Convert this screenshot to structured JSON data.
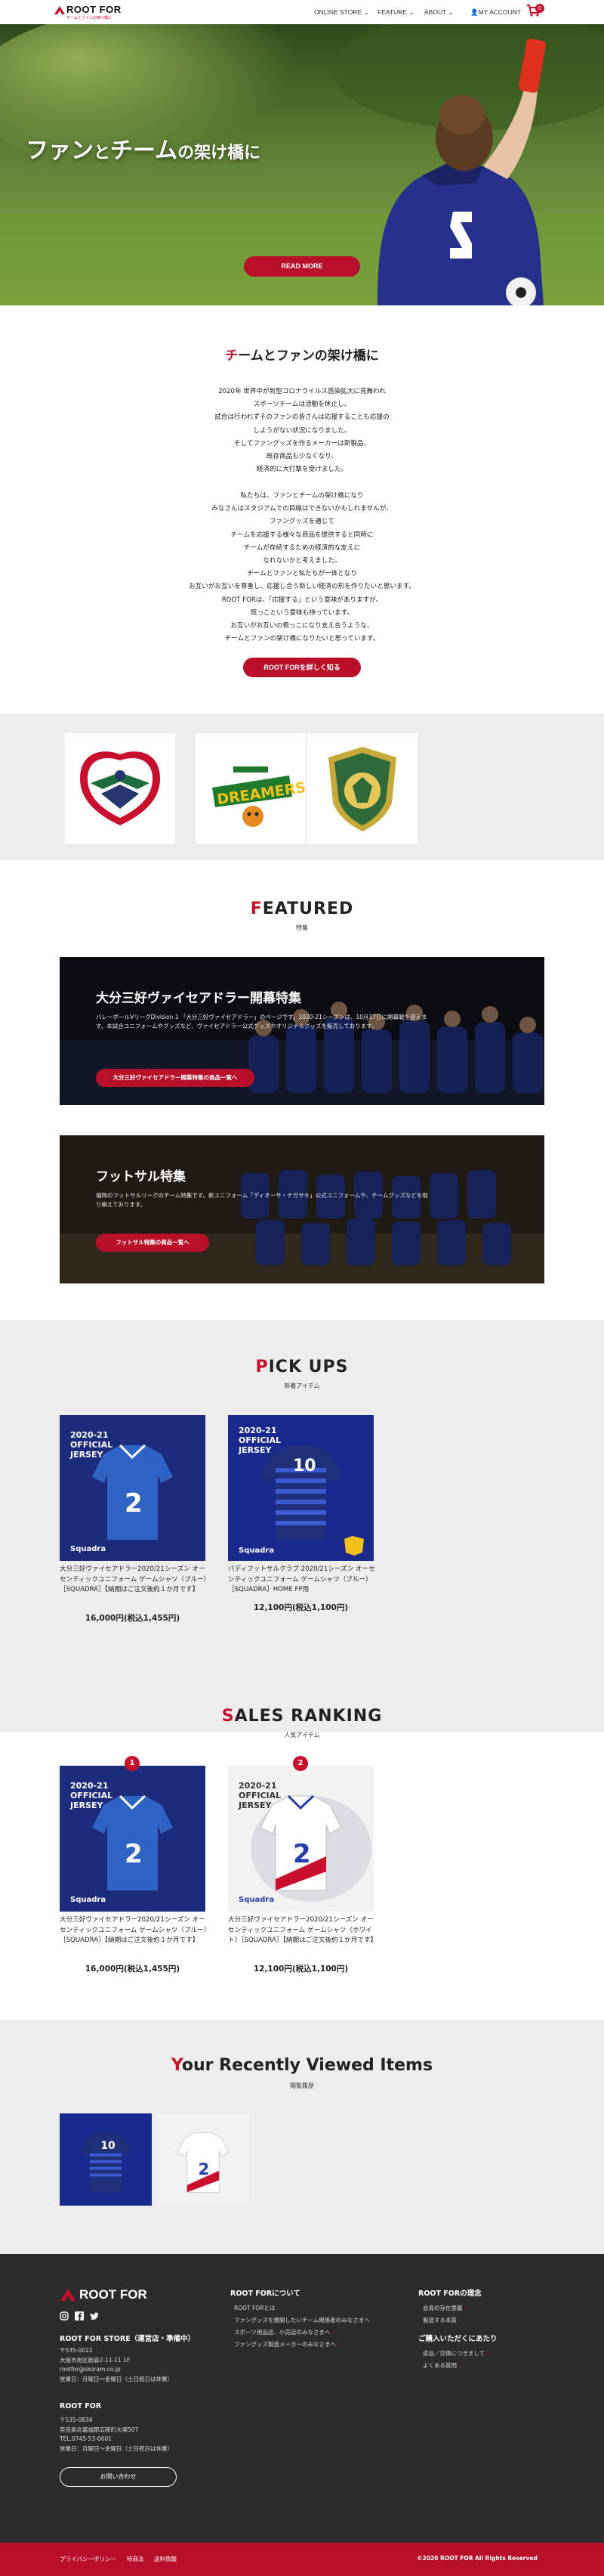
{
  "header": {
    "logo_text": "ROOT FOR",
    "logo_sub": "チームとファンの架け橋に",
    "nav": [
      {
        "label": "ONLINE STORE",
        "has_caret": true
      },
      {
        "label": "FEATURE",
        "has_caret": true
      },
      {
        "label": "ABOUT",
        "has_caret": true
      },
      {
        "label": "MY ACCOUNT",
        "has_caret": false
      }
    ],
    "cart_count": "0"
  },
  "hero": {
    "copy_part1": "ファン",
    "copy_part2": "と",
    "copy_part3": "チーム",
    "copy_part4": "の架け橋に",
    "button": "READ MORE"
  },
  "intro": {
    "title_first": "チ",
    "title_rest": "ームとファンの架け橋に",
    "paragraph1": [
      "2020年 世界中が新型コロナウイルス感染拡大に見舞われ",
      "スポーツチームは活動を休止し、",
      "試合は行われずそのファンの皆さんは応援することも応援の",
      "しようがない状況になりました。",
      "そしてファングッズを作るメーカーは新製品、",
      "既存商品も少なくなり、",
      "経済的に大打撃を受けました。"
    ],
    "paragraph2": [
      "私たちは、ファンとチームの架け橋になり",
      "みなさんはスタジアムでの目線はできないかもしれませんが、",
      "ファングッズを通じて",
      "チームを応援する様々な商品を提供すると同時に",
      "チームが存続するための経済的な支えに",
      "なれないかと考えました。",
      "チームとファンと私たちが一体となり",
      "お互いがお互いを尊重し、応援し合う新しい経済の形を作りたいと思います。",
      "ROOT FORは、「応援する」という意味がありますが、",
      "既っこという意味も持っています。",
      "お互いがお互いの根っこになり支え合うような、",
      "チームとファンの架け橋になりたいと思っています。"
    ],
    "button": "ROOT FORを詳しく知る"
  },
  "featured": {
    "title_first": "F",
    "title_rest": "EATURED",
    "subtitle": "特集",
    "cards": [
      {
        "title": "大分三好ヴァイセアドラー開幕特集",
        "text": "バレーボールVリーグDivision 1 「大分三好ヴァイセアドラー」のページです。2020-21シーズンは、10月17日に開幕戦を迎えます。本試合ユニフォームやグッズなど、ヴァイセアドラー公式グッズやオリジナルグッズを販売しております。",
        "button": "大分三好ヴァイセアドラー開幕特集の商品一覧へ"
      },
      {
        "title": "フットサル特集",
        "text": "福岡のフットサルリーグのチーム特集です。新ユニフォーム「ディオーサ・ナガサキ」公式ユニフォームや、チームグッズなどを取り揃えております。",
        "button": "フットサル特集の商品一覧へ"
      }
    ]
  },
  "pickups": {
    "title_first": "P",
    "title_rest": "ICK UPS",
    "subtitle": "新着アイテム",
    "items": [
      {
        "name": "大分三好ヴァイセアドラー2020/21シーズン オーセンティックユニフォーム ゲームシャツ（ブルー）［SQUADRA］【納期はご注文後約１か月です】",
        "price": "16,000円(税込1,455円)"
      },
      {
        "name": "バディフットサルクラブ 2020/21シーズン オーセンティックユニフォーム ゲームシャツ（ブルー）［SQUADRA］HOME FP用",
        "price": "12,100円(税込1,100円)"
      }
    ]
  },
  "ranking": {
    "title_first": "S",
    "title_rest": "ALES RANKING",
    "subtitle": "人気アイテム",
    "items": [
      {
        "rank": "1",
        "name": "大分三好ヴァイセアドラー2020/21シーズン オーセンティックユニフォーム ゲームシャツ（ブルー）［SQUADRA］【納期はご注文後約１か月です】",
        "price": "16,000円(税込1,455円)"
      },
      {
        "rank": "2",
        "name": "大分三好ヴァイセアドラー2020/21シーズン オーセンティックユニフォーム ゲームシャツ（ホワイト）［SQUADRA］【納期はご注文後約１か月です】",
        "price": "12,100円(税込1,100円)"
      }
    ]
  },
  "recent": {
    "title_first": "Y",
    "title_rest": "our Recently Viewed Items",
    "subtitle": "閲覧履歴"
  },
  "jersey_text": {
    "season": "2020-21",
    "official": "OFFICIAL",
    "jersey": "JERSEY",
    "brand": "Squadra"
  },
  "footer": {
    "logo_text": "ROOT FOR",
    "store_head": "ROOT FOR STORE（運営店・準備中）",
    "store_lines": [
      "〒535-0022",
      "大阪市旭区新森2-11-11 1F",
      "rootfor@skoram.co.jp",
      "営業日：月曜日～金曜日（土日祝日は休業）"
    ],
    "office_head": "ROOT FOR",
    "office_lines": [
      "〒535-0834",
      "奈良県北葛城郡広陵町大塚507",
      "TEL.0745-53-0001",
      "営業日：月曜日～金曜日（土日祝日は休業）"
    ],
    "contact_button": "お問い合わせ",
    "about_head": "ROOT FORについて",
    "about_links": [
      "ROOT FORとは",
      "ファングッズを展開したいチーム関係者のみなさまへ",
      "スポーツ用品店、小売店のみなさまへ",
      "ファングッズ製造メーカーのみなさまへ"
    ],
    "philosophy_head": "ROOT FORの理念",
    "philosophy_links": [
      "会員の存在意義",
      "製造する本質"
    ],
    "guide_head": "ご購入いただくにあたり",
    "guide_links": [
      "返品／交換につきまして",
      "よくある質問"
    ],
    "bottom_links": [
      "プライバシーポリシー",
      "特商法",
      "送料情報"
    ],
    "copyright": "©2020 ROOT FOR All Rights Reserved"
  },
  "colors": {
    "accent": "#c8102e",
    "footer_bg": "#2c2c2c",
    "band_bg": "#ededed"
  }
}
